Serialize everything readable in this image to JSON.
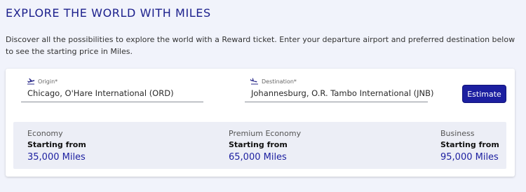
{
  "header": {
    "title": "EXPLORE THE WORLD WITH MILES",
    "description": "Discover all the possibilities to explore the world with a Reward ticket. Enter your departure airport and preferred destination below to see the starting price in Miles."
  },
  "form": {
    "origin": {
      "label": "Origin*",
      "value": "Chicago, O'Hare International (ORD)",
      "icon": "plane-takeoff-icon"
    },
    "destination": {
      "label": "Destination*",
      "value": "Johannesburg, O.R. Tambo International (JNB)",
      "icon": "plane-landing-icon"
    },
    "estimate_label": "Estimate"
  },
  "fares": [
    {
      "class": "Economy",
      "from_label": "Starting from",
      "price": "35,000 Miles"
    },
    {
      "class": "Premium Economy",
      "from_label": "Starting from",
      "price": "65,000 Miles"
    },
    {
      "class": "Business",
      "from_label": "Starting from",
      "price": "95,000 Miles"
    }
  ],
  "colors": {
    "brand_navy": "#1c1fa0",
    "title_navy": "#1b1f8c",
    "page_bg": "#f1f3fb",
    "fares_bg": "#eceef6"
  }
}
